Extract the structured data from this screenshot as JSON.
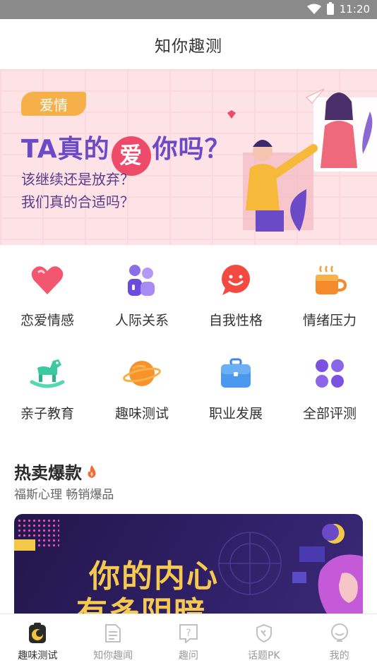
{
  "status_bar": {
    "time": "11:20"
  },
  "header": {
    "title": "知你趣测"
  },
  "banner": {
    "tag": "爱情",
    "headline_pre": "TA真的",
    "headline_love": "爱",
    "headline_post": "你吗？",
    "line1": "该继续还是放弃？",
    "line2": "我们真的合适吗？"
  },
  "categories": [
    {
      "label": "恋爱情感",
      "icon": "heart-icon"
    },
    {
      "label": "人际关系",
      "icon": "people-icon"
    },
    {
      "label": "自我性格",
      "icon": "smile-chat-icon"
    },
    {
      "label": "情绪压力",
      "icon": "coffee-cup-icon"
    },
    {
      "label": "亲子教育",
      "icon": "rocking-horse-icon"
    },
    {
      "label": "趣味测试",
      "icon": "planet-icon"
    },
    {
      "label": "职业发展",
      "icon": "briefcase-icon"
    },
    {
      "label": "全部评测",
      "icon": "grid-icon"
    }
  ],
  "hot": {
    "title": "热卖爆款",
    "subtitle": "福斯心理 畅销爆品",
    "card_line1": "你的内心",
    "card_line2": "有多阴暗"
  },
  "tabs": [
    {
      "label": "趣味测试",
      "icon": "test-icon",
      "active": true
    },
    {
      "label": "知你趣闻",
      "icon": "news-icon",
      "active": false
    },
    {
      "label": "趣问",
      "icon": "question-icon",
      "active": false
    },
    {
      "label": "话题PK",
      "icon": "shield-pk-icon",
      "active": false
    },
    {
      "label": "我的",
      "icon": "profile-icon",
      "active": false
    }
  ],
  "colors": {
    "accent": "#f5b04a",
    "banner_bg": "#fde3e6",
    "headline": "#6b4ac8",
    "love": "#ee4a6a",
    "card_text": "#f6c94f"
  }
}
